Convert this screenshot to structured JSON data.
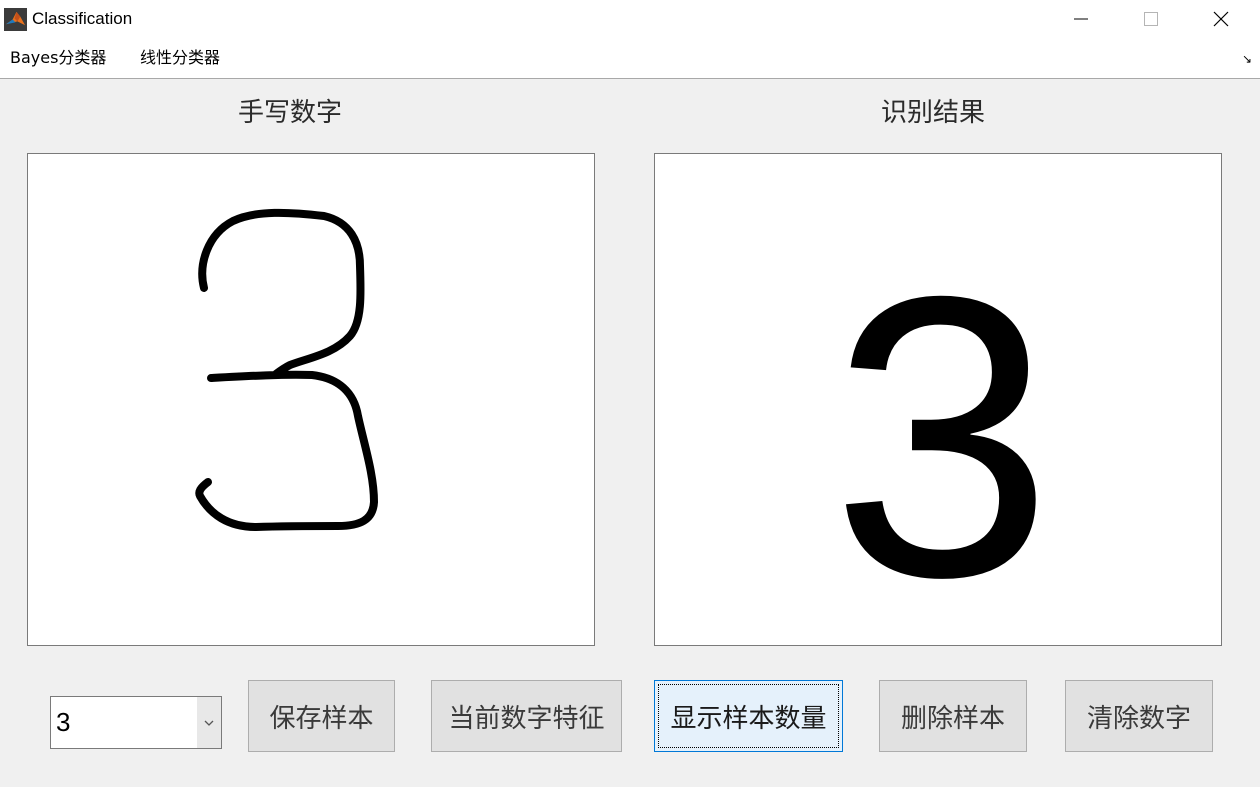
{
  "window": {
    "title": "Classification",
    "minimize_glyph": "—",
    "close_glyph": "✕"
  },
  "menu": {
    "items": [
      {
        "label": "Bayes分类器"
      },
      {
        "label": "线性分类器"
      }
    ],
    "dock_glyph": "↘"
  },
  "panels": {
    "left_title": "手写数字",
    "right_title": "识别结果",
    "result_digit": "3"
  },
  "controls": {
    "digit_select_value": "3",
    "buttons": [
      {
        "label": "保存样本"
      },
      {
        "label": "当前数字特征"
      },
      {
        "label": "显示样本数量"
      },
      {
        "label": "删除样本"
      },
      {
        "label": "清除数字"
      }
    ]
  },
  "colors": {
    "background": "#f0f0f0",
    "focus_border": "#0078d7",
    "focus_fill": "#e5f1fb"
  },
  "icons": {
    "app": "matlab-logo-icon",
    "dropdown": "chevron-down-icon"
  }
}
